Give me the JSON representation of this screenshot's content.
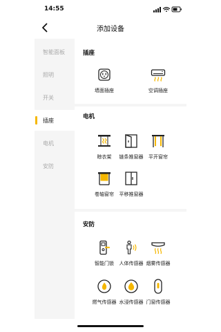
{
  "status_bar": {
    "time": "14:55"
  },
  "nav": {
    "title": "添加设备"
  },
  "sidebar": {
    "accent_color": "#f5b700",
    "items": [
      {
        "label": "智能面板",
        "active": false
      },
      {
        "label": "照明",
        "active": false
      },
      {
        "label": "开关",
        "active": false
      },
      {
        "label": "插座",
        "active": true
      },
      {
        "label": "电机",
        "active": false
      },
      {
        "label": "安防",
        "active": false
      }
    ]
  },
  "sections": {
    "socket": {
      "title": "插座",
      "devices": [
        {
          "label": "墙面插座",
          "icon": "wall-socket-icon"
        },
        {
          "label": "空调插座",
          "icon": "ac-socket-icon"
        }
      ]
    },
    "motor": {
      "title": "电机",
      "devices": [
        {
          "label": "晾衣架",
          "icon": "clothes-rack-icon"
        },
        {
          "label": "链条推窗器",
          "icon": "chain-window-opener-icon"
        },
        {
          "label": "平开窗帘",
          "icon": "curtain-icon"
        },
        {
          "label": "卷轴窗帘",
          "icon": "roller-blind-icon"
        },
        {
          "label": "平移推窗器",
          "icon": "sliding-window-opener-icon"
        }
      ]
    },
    "security": {
      "title": "安防",
      "devices": [
        {
          "label": "智能门锁",
          "icon": "smart-lock-icon"
        },
        {
          "label": "人体传感器",
          "icon": "motion-sensor-icon"
        },
        {
          "label": "烟雾传感器",
          "icon": "smoke-sensor-icon"
        },
        {
          "label": "燃气传感器",
          "icon": "gas-sensor-icon"
        },
        {
          "label": "水浸传感器",
          "icon": "water-leak-sensor-icon"
        },
        {
          "label": "门窗传感器",
          "icon": "door-window-sensor-icon"
        }
      ]
    }
  }
}
